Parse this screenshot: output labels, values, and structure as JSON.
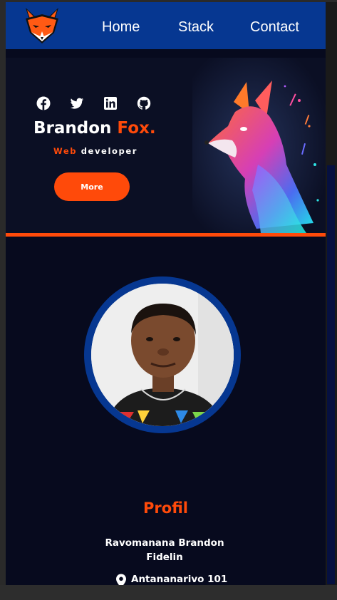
{
  "nav": {
    "items": [
      {
        "label": "Home"
      },
      {
        "label": "Stack"
      },
      {
        "label": "Contact"
      }
    ]
  },
  "hero": {
    "name_first": "Brandon ",
    "name_accent": "Fox.",
    "role_accent": "Web",
    "role_rest": " developer",
    "button_label": "More",
    "socials": [
      "facebook-icon",
      "twitter-icon",
      "linkedin-icon",
      "github-icon"
    ]
  },
  "profile": {
    "title": "Profil",
    "full_name": "Ravomanana Brandon Fidelin",
    "location": "Antananarivo 101"
  },
  "colors": {
    "accent": "#ff4a0a",
    "nav_bg": "#063791",
    "page_bg": "#070a1e"
  }
}
